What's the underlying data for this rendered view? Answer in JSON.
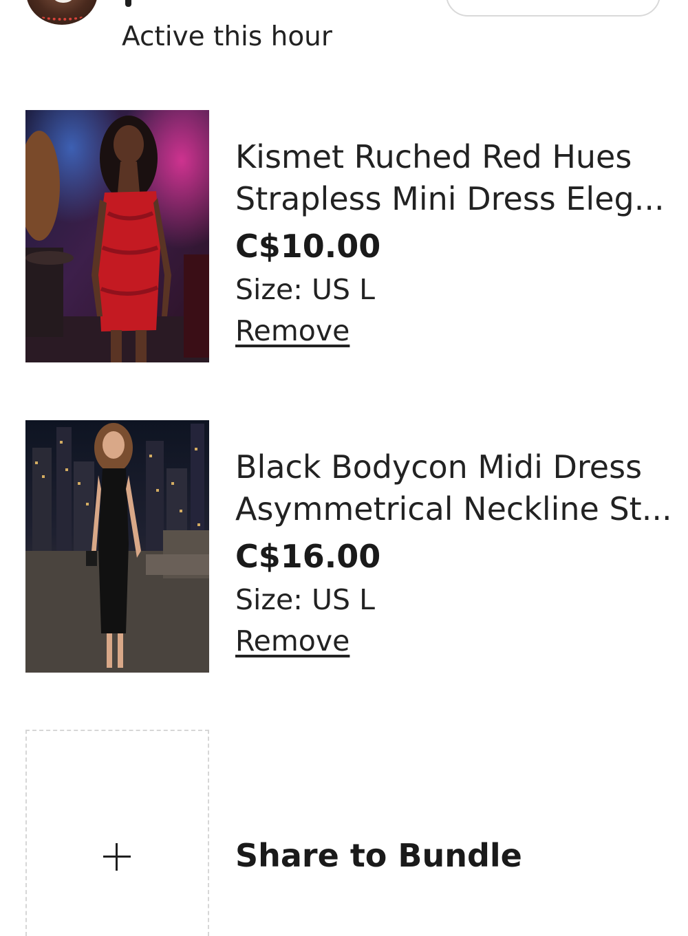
{
  "seller": {
    "status": "Active this hour"
  },
  "items": [
    {
      "title_line1": "Kismet Ruched Red Hues",
      "title_line2": "Strapless Mini Dress Eleg...",
      "price": "C$10.00",
      "size": "Size: US L",
      "remove_label": "Remove"
    },
    {
      "title_line1": "Black Bodycon Midi Dress",
      "title_line2": "Asymmetrical Neckline St...",
      "price": "C$16.00",
      "size": "Size: US L",
      "remove_label": "Remove"
    }
  ],
  "bundle": {
    "label": "Share to Bundle",
    "icon": "plus-icon"
  },
  "colors": {
    "text": "#1f1f1f",
    "dashed_border": "#d6d6d6",
    "dress_red": "#c41a22",
    "dress_black": "#111111"
  }
}
